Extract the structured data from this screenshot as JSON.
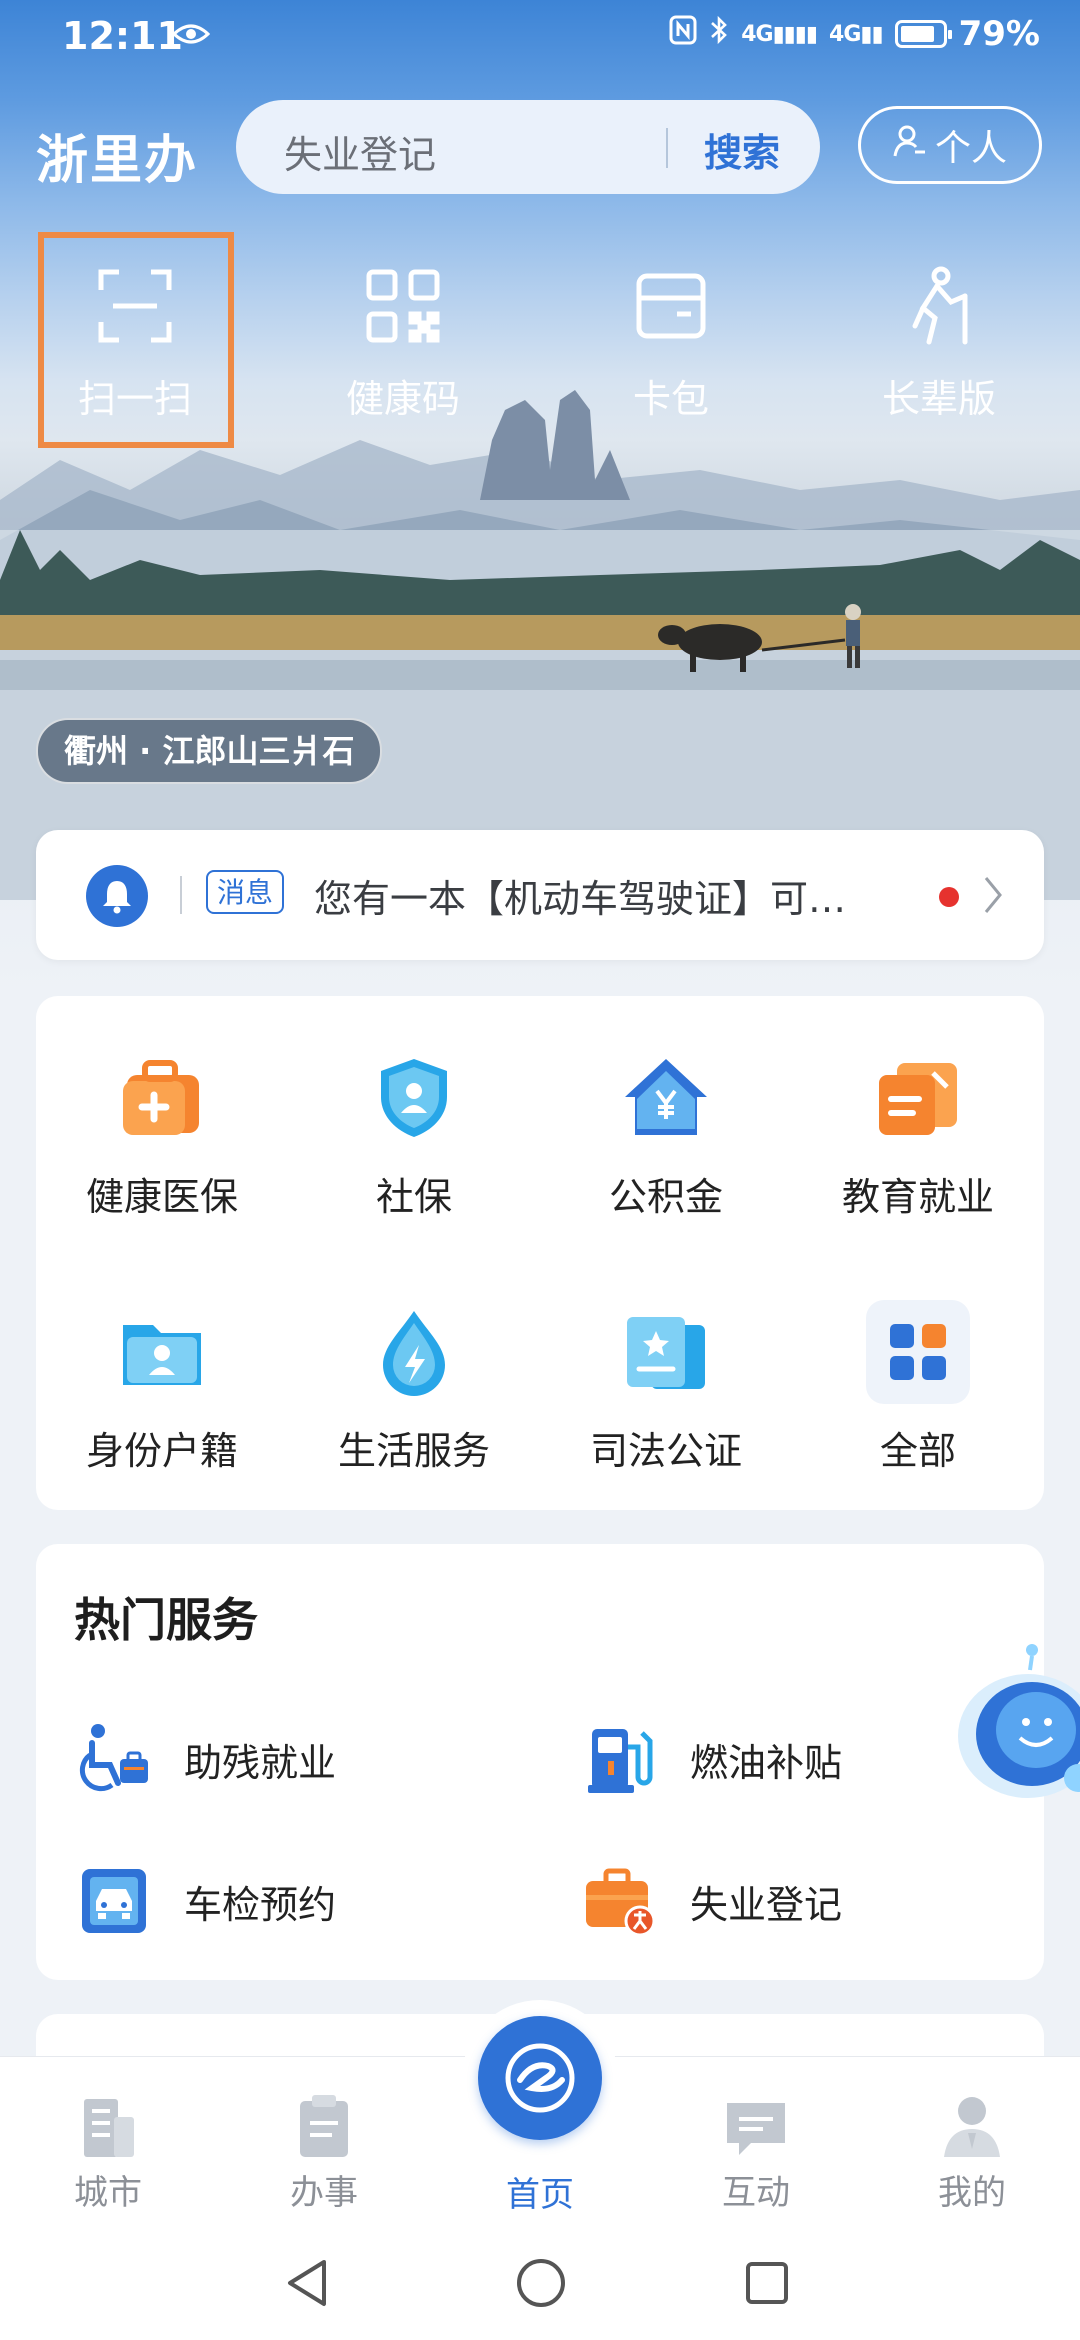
{
  "status_bar": {
    "time": "12:11",
    "network": "4G",
    "battery": "79%"
  },
  "header": {
    "app_name": "浙里办",
    "search_placeholder": "失业登记",
    "search_button": "搜索",
    "personal_button": "个人"
  },
  "quick_actions": [
    {
      "label": "扫一扫",
      "icon": "scan-icon"
    },
    {
      "label": "健康码",
      "icon": "qr-code-icon"
    },
    {
      "label": "卡包",
      "icon": "wallet-icon"
    },
    {
      "label": "长辈版",
      "icon": "elder-icon"
    }
  ],
  "hero": {
    "location_caption": "衢州 · 江郎山三爿石"
  },
  "notice": {
    "tag": "消息",
    "message": "您有一本【机动车驾驶证】可…"
  },
  "services": [
    {
      "label": "健康医保",
      "icon": "medical-kit-icon",
      "color": "#f5842f"
    },
    {
      "label": "社保",
      "icon": "shield-person-icon",
      "color": "#28a6e8"
    },
    {
      "label": "公积金",
      "icon": "house-yuan-icon",
      "color": "#2f72d6"
    },
    {
      "label": "教育就业",
      "icon": "education-icon",
      "color": "#f5842f"
    },
    {
      "label": "身份户籍",
      "icon": "id-folder-icon",
      "color": "#28a6e8"
    },
    {
      "label": "生活服务",
      "icon": "drop-bolt-icon",
      "color": "#28a6e8"
    },
    {
      "label": "司法公证",
      "icon": "certificate-icon",
      "color": "#28a6e8"
    },
    {
      "label": "全部",
      "icon": "grid-apps-icon",
      "color": "#2f72d6"
    }
  ],
  "hot_services": {
    "title": "热门服务",
    "items": [
      {
        "label": "助残就业",
        "icon": "wheelchair-icon"
      },
      {
        "label": "燃油补贴",
        "icon": "fuel-pump-icon"
      },
      {
        "label": "车检预约",
        "icon": "car-inspection-icon"
      },
      {
        "label": "失业登记",
        "icon": "briefcase-icon"
      }
    ]
  },
  "tabbar": [
    {
      "label": "城市",
      "icon": "city-icon",
      "active": false
    },
    {
      "label": "办事",
      "icon": "clipboard-icon",
      "active": false
    },
    {
      "label": "首页",
      "icon": "home-logo-icon",
      "active": true
    },
    {
      "label": "互动",
      "icon": "chat-icon",
      "active": false
    },
    {
      "label": "我的",
      "icon": "profile-icon",
      "active": false
    }
  ],
  "colors": {
    "accent": "#2f72d6",
    "orange": "#f5842f",
    "highlight_border": "#ee8a45",
    "alert": "#e6322e"
  }
}
